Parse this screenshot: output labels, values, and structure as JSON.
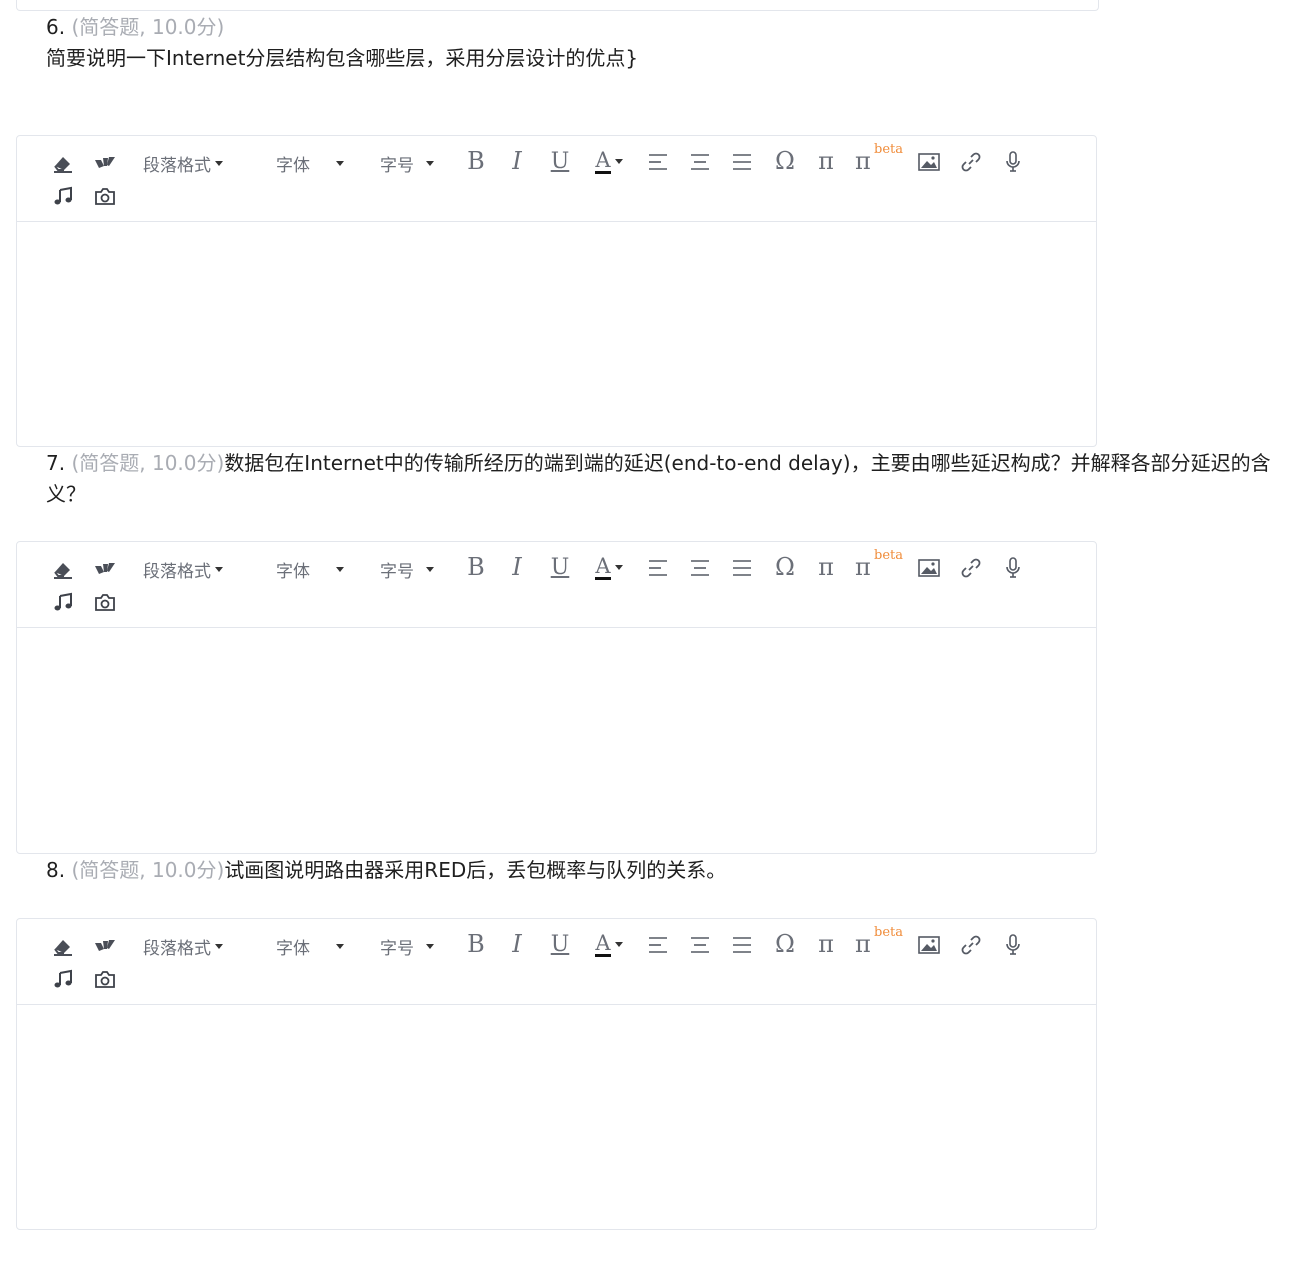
{
  "toolbar": {
    "paragraph_format_label": "段落格式",
    "font_label": "字体",
    "font_size_label": "字号",
    "bold_label": "B",
    "italic_label": "I",
    "underline_label": "U",
    "font_color_label": "A",
    "omega_label": "Ω",
    "pi_label": "π",
    "pi_beta_label": "π",
    "beta_label": "beta",
    "icons": [
      "eraser-icon",
      "format-painter-icon",
      "align-left-icon",
      "align-center-icon",
      "align-justify-icon",
      "image-icon",
      "link-icon",
      "microphone-icon",
      "music-icon",
      "camera-icon"
    ]
  },
  "questions": [
    {
      "number": "6.",
      "meta": "(简答题, 10.0分)",
      "text": "简要说明一下Internet分层结构包含哪些层，采用分层设计的优点}"
    },
    {
      "number": "7.",
      "meta": "(简答题, 10.0分)",
      "text": "数据包在Internet中的传输所经历的端到端的延迟(end-to-end delay)，主要由哪些延迟构成？并解释各部分延迟的含义？"
    },
    {
      "number": "8.",
      "meta": "(简答题, 10.0分)",
      "text": "试画图说明路由器采用RED后，丢包概率与队列的关系。"
    }
  ]
}
